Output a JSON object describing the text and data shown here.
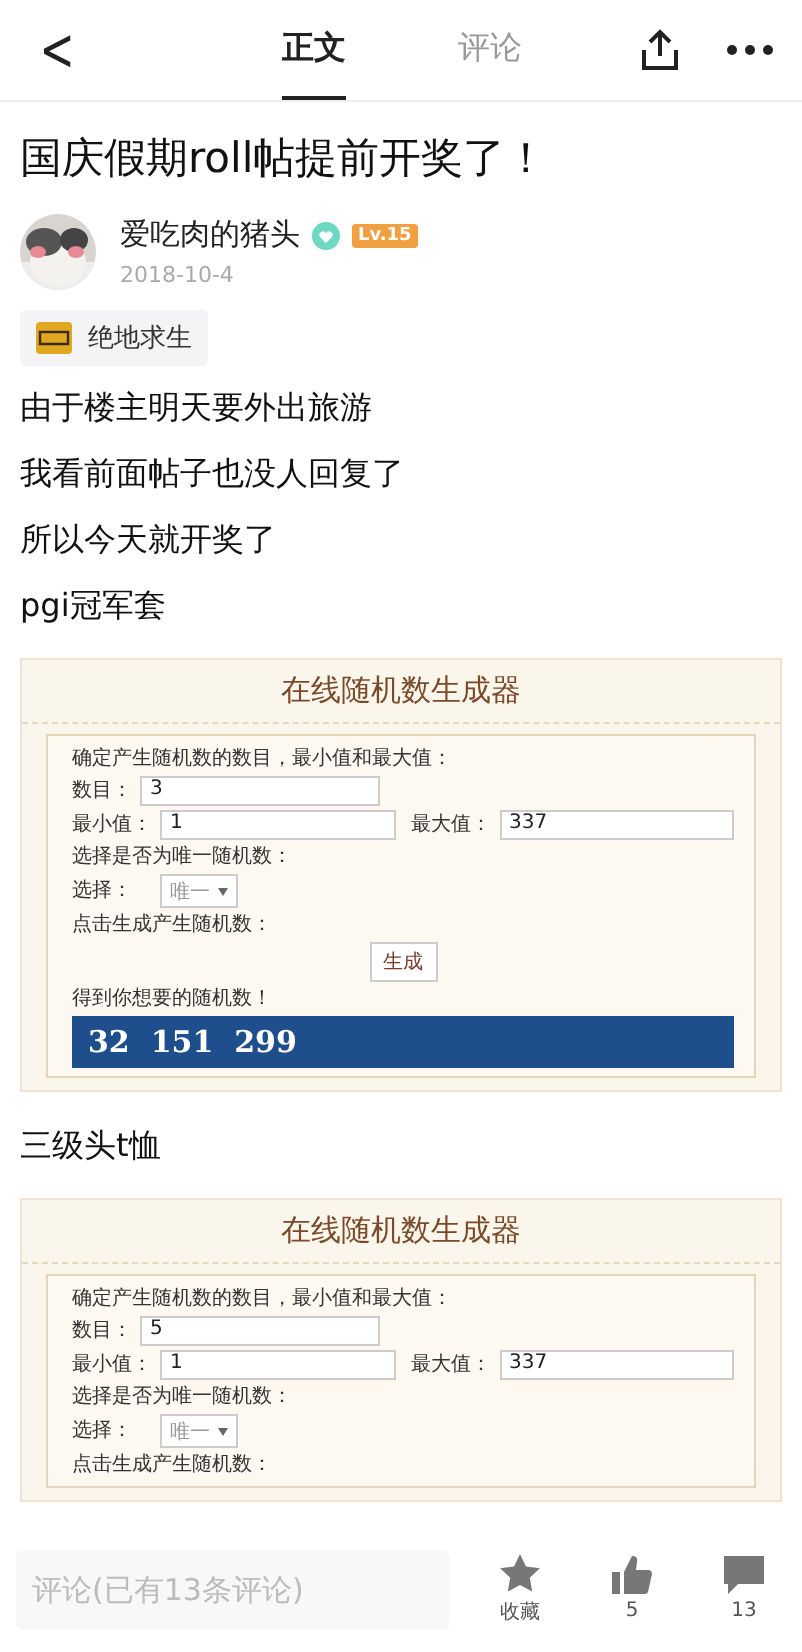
{
  "nav": {
    "back": "<",
    "tabs": [
      {
        "label": "正文",
        "selected": true
      },
      {
        "label": "评论",
        "selected": false
      }
    ]
  },
  "post": {
    "title": "国庆假期roll帖提前开奖了！",
    "author": {
      "name": "爱吃肉的猪头",
      "level": "Lv.15",
      "date": "2018-10-4"
    },
    "tag": "绝地求生",
    "blocks": [
      {
        "kind": "text",
        "text": "由于楼主明天要外出旅游"
      },
      {
        "kind": "text",
        "text": "我看前面帖子也没人回复了"
      },
      {
        "kind": "text",
        "text": "所以今天就开奖了"
      },
      {
        "kind": "text",
        "text": "pgi冠军套"
      },
      {
        "kind": "generator",
        "title": "在线随机数生成器",
        "intro": "确定产生随机数的数目，最小值和最大值：",
        "count_label": "数目：",
        "count": "3",
        "min_label": "最小值：",
        "min": "1",
        "max_label": "最大值：",
        "max": "337",
        "unique_label": "选择是否为唯一随机数：",
        "select_label": "选择：",
        "select_value": "唯一",
        "generate_label": "点击生成产生随机数：",
        "button": "生成",
        "result_label": "得到你想要的随机数！",
        "result": "32  151  299"
      },
      {
        "kind": "text",
        "text": "三级头t恤"
      },
      {
        "kind": "generator",
        "title": "在线随机数生成器",
        "intro": "确定产生随机数的数目，最小值和最大值：",
        "count_label": "数目：",
        "count": "5",
        "min_label": "最小值：",
        "min": "1",
        "max_label": "最大值：",
        "max": "337",
        "unique_label": "选择是否为唯一随机数：",
        "select_label": "选择：",
        "select_value": "唯一",
        "generate_label": "点击生成产生随机数："
      }
    ]
  },
  "bottom_bar": {
    "placeholder": "评论(已有13条评论)",
    "favorite": "收藏",
    "likes": "5",
    "comments": "13"
  }
}
